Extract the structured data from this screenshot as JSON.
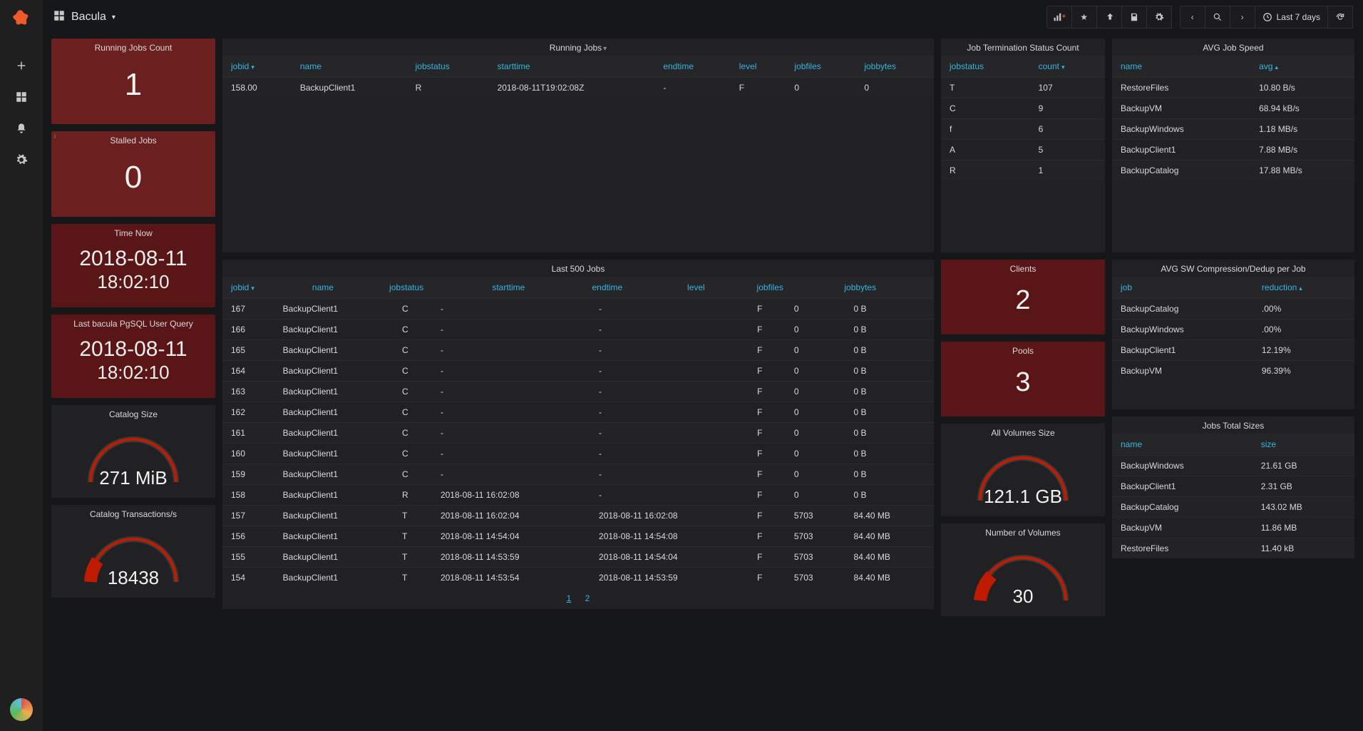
{
  "header": {
    "dashboard_name": "Bacula",
    "time_range": "Last 7 days"
  },
  "panels": {
    "running_jobs_count": {
      "title": "Running Jobs Count",
      "value": "1"
    },
    "stalled_jobs": {
      "title": "Stalled Jobs",
      "value": "0"
    },
    "time_now": {
      "title": "Time Now",
      "date": "2018-08-11",
      "time": "18:02:10"
    },
    "last_query": {
      "title": "Last bacula PgSQL User Query",
      "date": "2018-08-11",
      "time": "18:02:10"
    },
    "catalog_size": {
      "title": "Catalog Size",
      "value": "271 MiB"
    },
    "catalog_tx": {
      "title": "Catalog Transactions/s",
      "value": "18438"
    },
    "clients": {
      "title": "Clients",
      "value": "2"
    },
    "pools": {
      "title": "Pools",
      "value": "3"
    },
    "all_volumes_size": {
      "title": "All Volumes Size",
      "value": "121.1 GB"
    },
    "num_volumes": {
      "title": "Number of Volumes",
      "value": "30"
    }
  },
  "running_jobs": {
    "title": "Running Jobs",
    "columns": [
      "jobid",
      "name",
      "jobstatus",
      "starttime",
      "endtime",
      "level",
      "jobfiles",
      "jobbytes"
    ],
    "rows": [
      {
        "jobid": "158.00",
        "name": "BackupClient1",
        "jobstatus": "R",
        "starttime": "2018-08-11T19:02:08Z",
        "endtime": "-",
        "level": "F",
        "jobfiles": "0",
        "jobbytes": "0"
      }
    ]
  },
  "last500": {
    "title": "Last 500 Jobs",
    "columns": [
      "jobid",
      "name",
      "jobstatus",
      "starttime",
      "endtime",
      "level",
      "jobfiles",
      "jobbytes"
    ],
    "rows": [
      {
        "jobid": "167",
        "name": "BackupClient1",
        "jobstatus": "C",
        "starttime": "-",
        "endtime": "-",
        "level": "F",
        "jobfiles": "0",
        "jobbytes": "0 B"
      },
      {
        "jobid": "166",
        "name": "BackupClient1",
        "jobstatus": "C",
        "starttime": "-",
        "endtime": "-",
        "level": "F",
        "jobfiles": "0",
        "jobbytes": "0 B"
      },
      {
        "jobid": "165",
        "name": "BackupClient1",
        "jobstatus": "C",
        "starttime": "-",
        "endtime": "-",
        "level": "F",
        "jobfiles": "0",
        "jobbytes": "0 B"
      },
      {
        "jobid": "164",
        "name": "BackupClient1",
        "jobstatus": "C",
        "starttime": "-",
        "endtime": "-",
        "level": "F",
        "jobfiles": "0",
        "jobbytes": "0 B"
      },
      {
        "jobid": "163",
        "name": "BackupClient1",
        "jobstatus": "C",
        "starttime": "-",
        "endtime": "-",
        "level": "F",
        "jobfiles": "0",
        "jobbytes": "0 B"
      },
      {
        "jobid": "162",
        "name": "BackupClient1",
        "jobstatus": "C",
        "starttime": "-",
        "endtime": "-",
        "level": "F",
        "jobfiles": "0",
        "jobbytes": "0 B"
      },
      {
        "jobid": "161",
        "name": "BackupClient1",
        "jobstatus": "C",
        "starttime": "-",
        "endtime": "-",
        "level": "F",
        "jobfiles": "0",
        "jobbytes": "0 B"
      },
      {
        "jobid": "160",
        "name": "BackupClient1",
        "jobstatus": "C",
        "starttime": "-",
        "endtime": "-",
        "level": "F",
        "jobfiles": "0",
        "jobbytes": "0 B"
      },
      {
        "jobid": "159",
        "name": "BackupClient1",
        "jobstatus": "C",
        "starttime": "-",
        "endtime": "-",
        "level": "F",
        "jobfiles": "0",
        "jobbytes": "0 B"
      },
      {
        "jobid": "158",
        "name": "BackupClient1",
        "jobstatus": "R",
        "starttime": "2018-08-11 16:02:08",
        "endtime": "-",
        "level": "F",
        "jobfiles": "0",
        "jobbytes": "0 B"
      },
      {
        "jobid": "157",
        "name": "BackupClient1",
        "jobstatus": "T",
        "starttime": "2018-08-11 16:02:04",
        "endtime": "2018-08-11 16:02:08",
        "level": "F",
        "jobfiles": "5703",
        "jobbytes": "84.40 MB"
      },
      {
        "jobid": "156",
        "name": "BackupClient1",
        "jobstatus": "T",
        "starttime": "2018-08-11 14:54:04",
        "endtime": "2018-08-11 14:54:08",
        "level": "F",
        "jobfiles": "5703",
        "jobbytes": "84.40 MB"
      },
      {
        "jobid": "155",
        "name": "BackupClient1",
        "jobstatus": "T",
        "starttime": "2018-08-11 14:53:59",
        "endtime": "2018-08-11 14:54:04",
        "level": "F",
        "jobfiles": "5703",
        "jobbytes": "84.40 MB"
      },
      {
        "jobid": "154",
        "name": "BackupClient1",
        "jobstatus": "T",
        "starttime": "2018-08-11 14:53:54",
        "endtime": "2018-08-11 14:53:59",
        "level": "F",
        "jobfiles": "5703",
        "jobbytes": "84.40 MB"
      }
    ],
    "pages": [
      "1",
      "2"
    ]
  },
  "term_status": {
    "title": "Job Termination Status Count",
    "columns": [
      "jobstatus",
      "count"
    ],
    "rows": [
      {
        "jobstatus": "T",
        "count": "107"
      },
      {
        "jobstatus": "C",
        "count": "9"
      },
      {
        "jobstatus": "f",
        "count": "6"
      },
      {
        "jobstatus": "A",
        "count": "5"
      },
      {
        "jobstatus": "R",
        "count": "1"
      }
    ]
  },
  "avg_speed": {
    "title": "AVG Job Speed",
    "columns": [
      "name",
      "avg"
    ],
    "rows": [
      {
        "name": "RestoreFiles",
        "avg": "10.80 B/s"
      },
      {
        "name": "BackupVM",
        "avg": "68.94 kB/s"
      },
      {
        "name": "BackupWindows",
        "avg": "1.18 MB/s"
      },
      {
        "name": "BackupClient1",
        "avg": "7.88 MB/s"
      },
      {
        "name": "BackupCatalog",
        "avg": "17.88 MB/s"
      }
    ]
  },
  "avg_compress": {
    "title": "AVG SW Compression/Dedup per Job",
    "columns": [
      "job",
      "reduction"
    ],
    "rows": [
      {
        "job": "BackupCatalog",
        "reduction": ".00%"
      },
      {
        "job": "BackupWindows",
        "reduction": ".00%"
      },
      {
        "job": "BackupClient1",
        "reduction": "12.19%"
      },
      {
        "job": "BackupVM",
        "reduction": "96.39%"
      }
    ]
  },
  "total_sizes": {
    "title": "Jobs Total Sizes",
    "columns": [
      "name",
      "size"
    ],
    "rows": [
      {
        "name": "BackupWindows",
        "size": "21.61 GB"
      },
      {
        "name": "BackupClient1",
        "size": "2.31 GB"
      },
      {
        "name": "BackupCatalog",
        "size": "143.02 MB"
      },
      {
        "name": "BackupVM",
        "size": "11.86 MB"
      },
      {
        "name": "RestoreFiles",
        "size": "11.40 kB"
      }
    ]
  }
}
